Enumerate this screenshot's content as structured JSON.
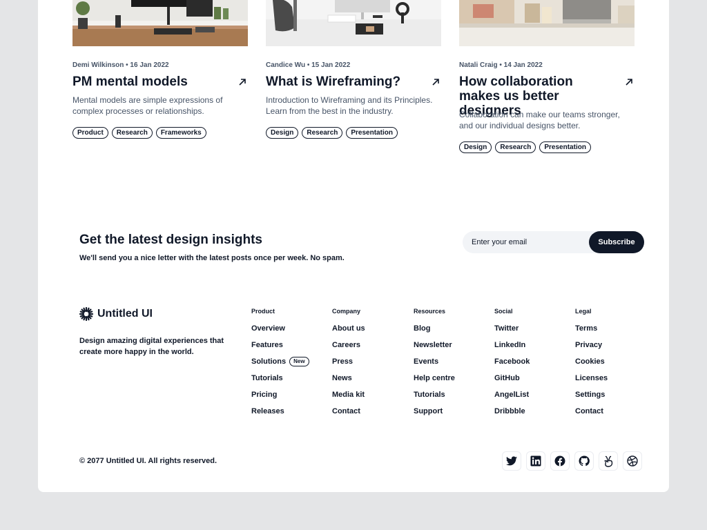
{
  "posts": [
    {
      "author_date": "Demi Wilkinson • 16 Jan 2022",
      "title": "PM mental models",
      "description": "Mental models are simple expressions of complex processes or relationships.",
      "tags": [
        "Product",
        "Research",
        "Frameworks"
      ]
    },
    {
      "author_date": "Candice Wu • 15 Jan 2022",
      "title": "What is Wireframing?",
      "description": "Introduction to Wireframing and its Principles. Learn from the best in the industry.",
      "tags": [
        "Design",
        "Research",
        "Presentation"
      ]
    },
    {
      "author_date": "Natali Craig • 14 Jan 2022",
      "title": "How collaboration makes us better designers",
      "description": "Collaboration can make our teams stronger, and our individual designs better.",
      "tags": [
        "Design",
        "Research",
        "Presentation"
      ]
    }
  ],
  "newsletter": {
    "title": "Get the latest design insights",
    "subtitle": "We'll send you a nice letter with the latest posts once per week. No spam.",
    "placeholder": "Enter your email",
    "button": "Subscribe"
  },
  "footer": {
    "logo": "Untitled UI",
    "tagline": "Design amazing digital experiences that create more happy in the world.",
    "columns": [
      {
        "heading": "Product",
        "links": [
          "Overview",
          "Features",
          "Solutions",
          "Tutorials",
          "Pricing",
          "Releases"
        ],
        "badge": "New"
      },
      {
        "heading": "Company",
        "links": [
          "About us",
          "Careers",
          "Press",
          "News",
          "Media kit",
          "Contact"
        ]
      },
      {
        "heading": "Resources",
        "links": [
          "Blog",
          "Newsletter",
          "Events",
          "Help centre",
          "Tutorials",
          "Support"
        ]
      },
      {
        "heading": "Social",
        "links": [
          "Twitter",
          "LinkedIn",
          "Facebook",
          "GitHub",
          "AngelList",
          "Dribbble"
        ]
      },
      {
        "heading": "Legal",
        "links": [
          "Terms",
          "Privacy",
          "Cookies",
          "Licenses",
          "Settings",
          "Contact"
        ]
      }
    ],
    "copyright": "© 2077 Untitled UI. All rights reserved.",
    "social_icons": [
      "twitter-icon",
      "linkedin-icon",
      "facebook-icon",
      "github-icon",
      "angellist-icon",
      "dribbble-icon"
    ]
  },
  "colors": {
    "text": "#101828",
    "muted": "#475467",
    "background": "#e4e5e7",
    "card": "#ffffff",
    "button": "#101828"
  }
}
